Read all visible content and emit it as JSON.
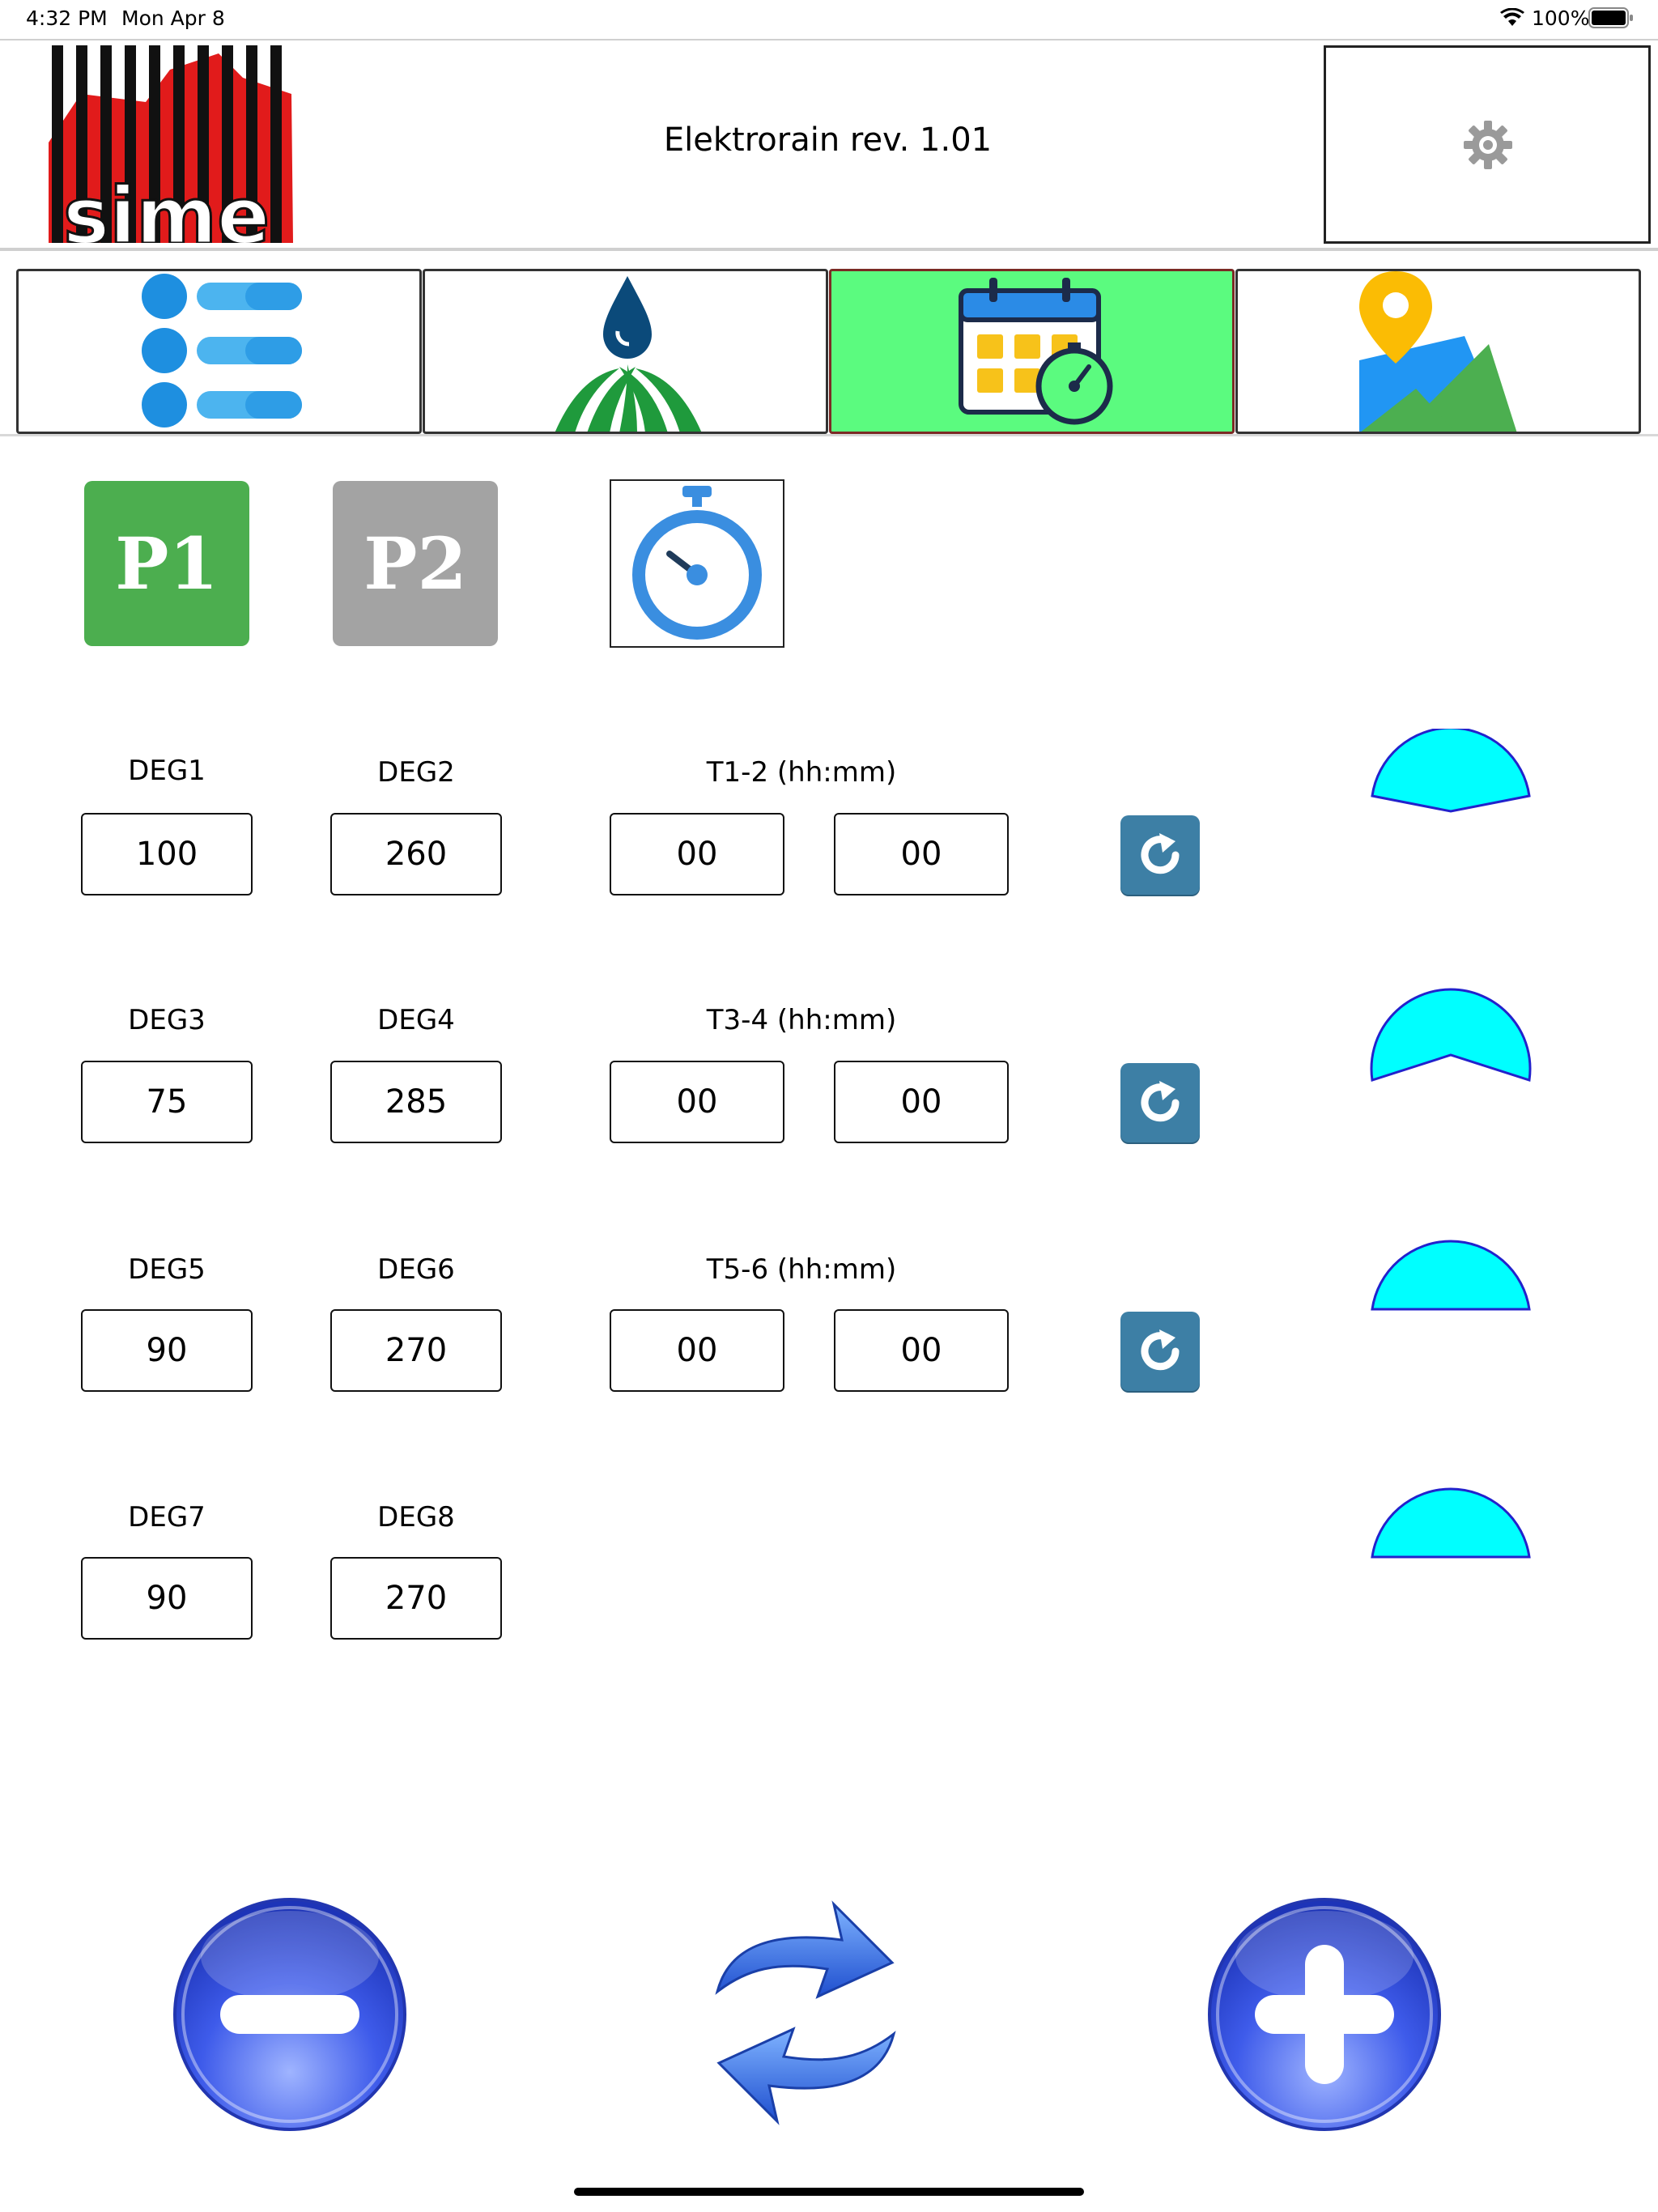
{
  "status_bar": {
    "time": "4:32 PM",
    "date": "Mon Apr 8",
    "battery": "100%"
  },
  "header": {
    "logo_text": "sime",
    "title": "Elektrorain rev. 1.01",
    "settings_icon": "gear-icon"
  },
  "tabs": [
    {
      "name": "list",
      "icon": "list-icon",
      "active": false
    },
    {
      "name": "irrigation",
      "icon": "water-drop-grass-icon",
      "active": false
    },
    {
      "name": "schedule",
      "icon": "calendar-timer-icon",
      "active": true
    },
    {
      "name": "map",
      "icon": "map-pin-icon",
      "active": false
    }
  ],
  "programs": {
    "p1_label": "P1",
    "p2_label": "P2",
    "timer_icon": "stopwatch-icon"
  },
  "rows": [
    {
      "deg_a_label": "DEG1",
      "deg_b_label": "DEG2",
      "deg_a": "100",
      "deg_b": "260",
      "time_label": "T1-2 (hh:mm)",
      "hh": "00",
      "mm": "00"
    },
    {
      "deg_a_label": "DEG3",
      "deg_b_label": "DEG4",
      "deg_a": "75",
      "deg_b": "285",
      "time_label": "T3-4 (hh:mm)",
      "hh": "00",
      "mm": "00"
    },
    {
      "deg_a_label": "DEG5",
      "deg_b_label": "DEG6",
      "deg_a": "90",
      "deg_b": "270",
      "time_label": "T5-6 (hh:mm)",
      "hh": "00",
      "mm": "00"
    },
    {
      "deg_a_label": "DEG7",
      "deg_b_label": "DEG8",
      "deg_a": "90",
      "deg_b": "270"
    }
  ],
  "sector_colors": {
    "fill": "#00ffff",
    "stroke": "#2222cc"
  },
  "bottom_controls": {
    "minus_icon": "minus-icon",
    "sync_icon": "sync-arrows-icon",
    "plus_icon": "plus-icon"
  }
}
